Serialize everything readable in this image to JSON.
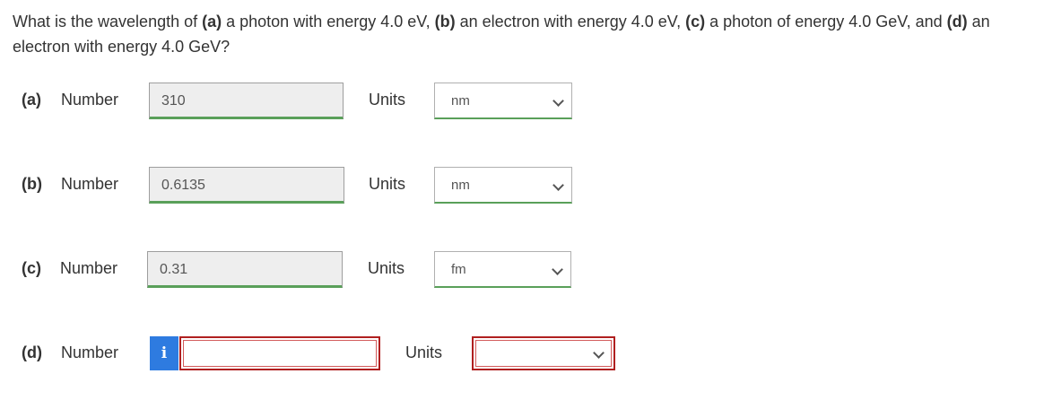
{
  "question": {
    "t1": "What is the wavelength of ",
    "a": "(a)",
    "t2": " a photon with energy 4.0 eV, ",
    "b": "(b)",
    "t3": " an electron with energy 4.0 eV, ",
    "c": "(c)",
    "t4": " a photon of energy 4.0 GeV, and ",
    "d": "(d)",
    "t5": " an",
    "line2": "electron with energy 4.0 GeV?"
  },
  "parts": [
    {
      "part": "(a)",
      "number_label": "Number",
      "value": "310",
      "units_label": "Units",
      "unit": "nm"
    },
    {
      "part": "(b)",
      "number_label": "Number",
      "value": "0.6135",
      "units_label": "Units",
      "unit": "nm"
    },
    {
      "part": "(c)",
      "number_label": "Number",
      "value": "0.31",
      "units_label": "Units",
      "unit": "fm"
    },
    {
      "part": "(d)",
      "number_label": "Number",
      "value": "",
      "units_label": "Units",
      "unit": "",
      "info_icon": "i"
    }
  ],
  "colors": {
    "correct": "#5aa05a",
    "error": "#b02020",
    "info": "#2e7be0"
  }
}
